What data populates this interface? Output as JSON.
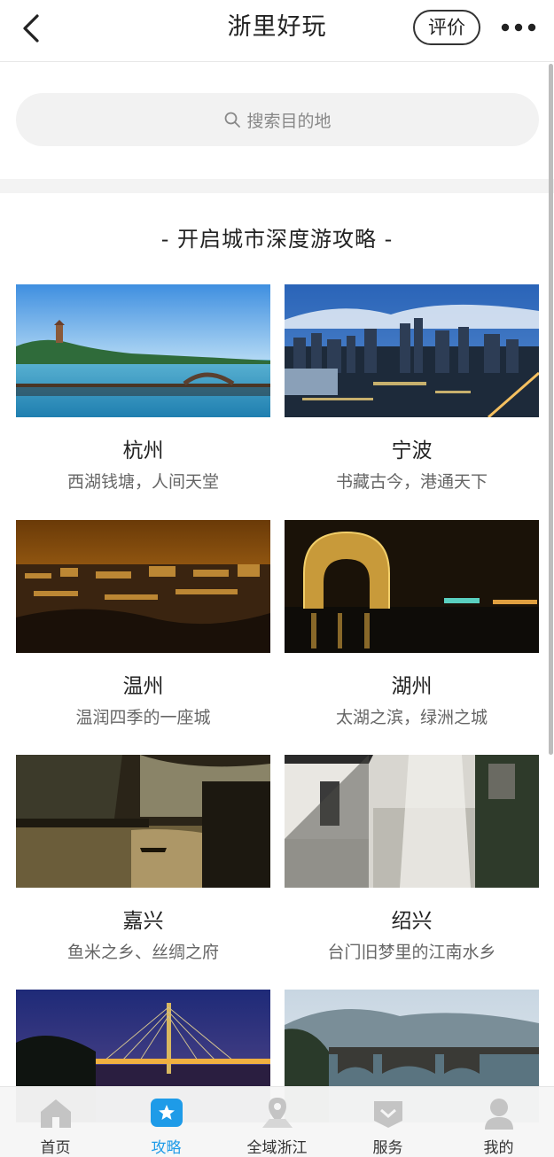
{
  "header": {
    "title": "浙里好玩",
    "rate_label": "评价"
  },
  "search": {
    "placeholder": "搜索目的地"
  },
  "section": {
    "title": "- 开启城市深度游攻略 -"
  },
  "cities": [
    {
      "name": "杭州",
      "tagline": "西湖钱塘，人间天堂"
    },
    {
      "name": "宁波",
      "tagline": "书藏古今，港通天下"
    },
    {
      "name": "温州",
      "tagline": "温润四季的一座城"
    },
    {
      "name": "湖州",
      "tagline": "太湖之滨，绿洲之城"
    },
    {
      "name": "嘉兴",
      "tagline": "鱼米之乡、丝绸之府"
    },
    {
      "name": "绍兴",
      "tagline": "台门旧梦里的江南水乡"
    }
  ],
  "tabbar": {
    "items": [
      {
        "label": "首页",
        "icon": "home-icon"
      },
      {
        "label": "攻略",
        "icon": "guide-icon"
      },
      {
        "label": "全域浙江",
        "icon": "map-pin-icon"
      },
      {
        "label": "服务",
        "icon": "service-icon"
      },
      {
        "label": "我的",
        "icon": "profile-icon"
      }
    ],
    "active_index": 1
  },
  "colors": {
    "accent": "#1e9be8",
    "tab_inactive_icon": "#c4c4c4"
  }
}
